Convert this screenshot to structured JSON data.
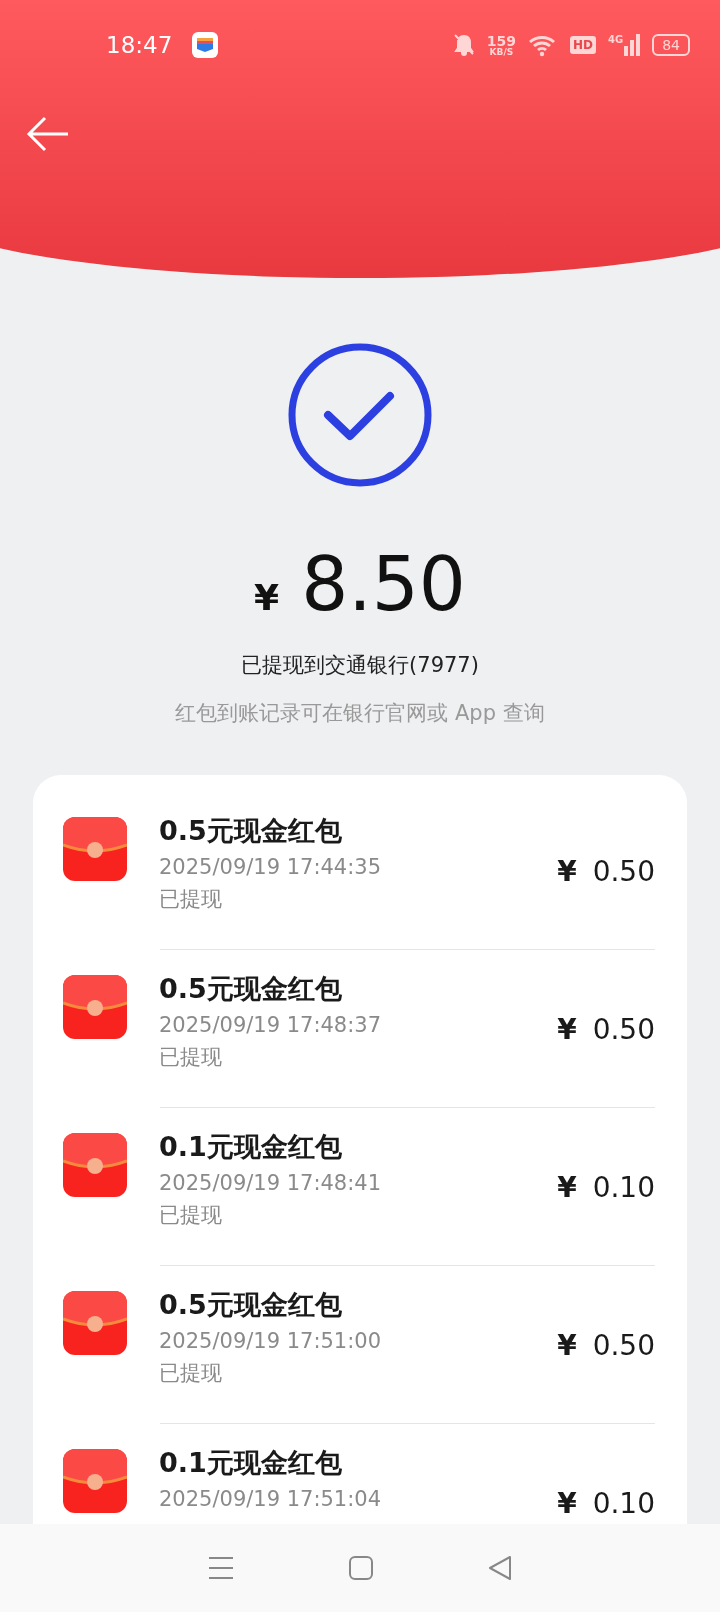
{
  "status_bar": {
    "time": "18:47",
    "speed": "159",
    "speed_unit": "KB/S",
    "hd": "HD",
    "network": "4G",
    "battery": "84"
  },
  "summary": {
    "currency": "¥",
    "amount": "8.50",
    "bank_line": "已提现到交通银行(7977)",
    "note": "红包到账记录可在银行官网或 App 查询"
  },
  "records": [
    {
      "title": "0.5元现金红包",
      "time": "2025/09/19 17:44:35",
      "status": "已提现",
      "currency": "¥",
      "amount": "0.50"
    },
    {
      "title": "0.5元现金红包",
      "time": "2025/09/19 17:48:37",
      "status": "已提现",
      "currency": "¥",
      "amount": "0.50"
    },
    {
      "title": "0.1元现金红包",
      "time": "2025/09/19 17:48:41",
      "status": "已提现",
      "currency": "¥",
      "amount": "0.10"
    },
    {
      "title": "0.5元现金红包",
      "time": "2025/09/19 17:51:00",
      "status": "已提现",
      "currency": "¥",
      "amount": "0.50"
    },
    {
      "title": "0.1元现金红包",
      "time": "2025/09/19 17:51:04",
      "currency": "¥",
      "amount": "0.10"
    }
  ]
}
